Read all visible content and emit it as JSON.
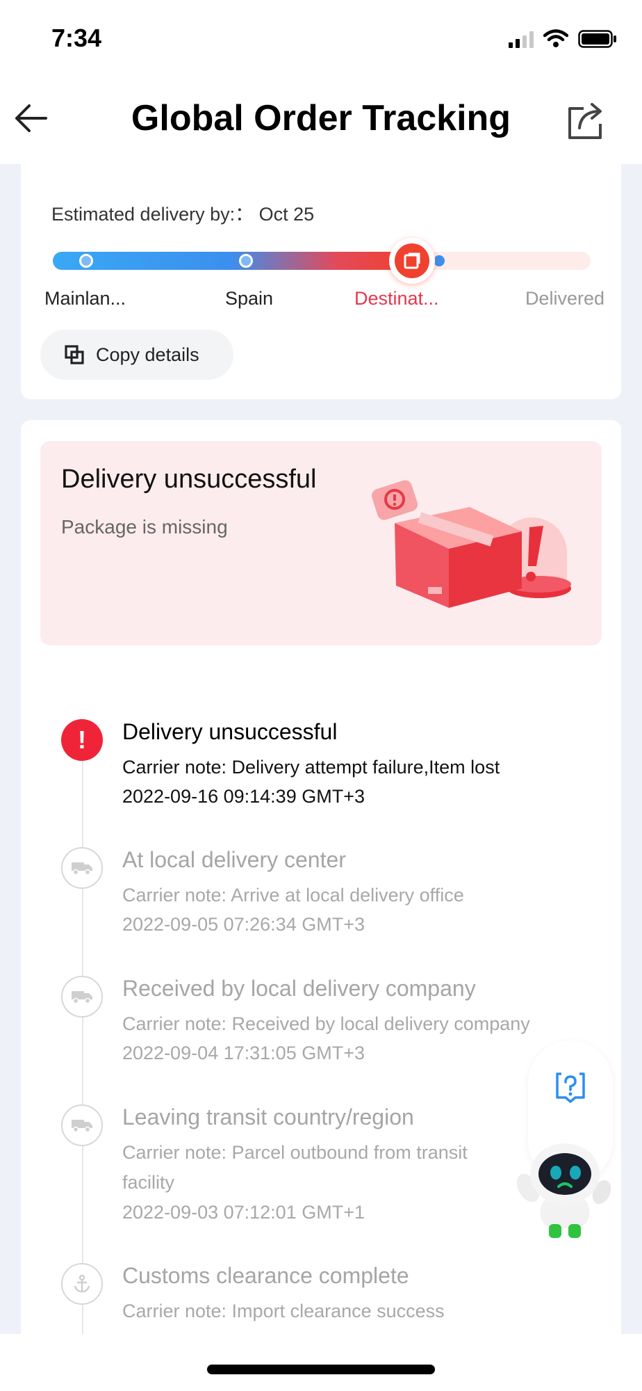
{
  "status_bar": {
    "time": "7:34"
  },
  "nav": {
    "title": "Global Order Tracking",
    "back_icon": "arrow-left-icon",
    "share_icon": "share-icon"
  },
  "summary": {
    "estimated_label": "Estimated delivery by:：",
    "estimated_value": "Oct 25",
    "stages": [
      "Mainlan...",
      "Spain",
      "Destinat...",
      "Delivered"
    ],
    "current_stage_index": 2,
    "progress_fraction": 0.66,
    "copy_label": "Copy details"
  },
  "alert": {
    "title": "Delivery unsuccessful",
    "subtitle": "Package is missing"
  },
  "events": [
    {
      "title": "Delivery unsuccessful",
      "note": "Carrier note: Delivery attempt failure,Item lost",
      "note2": "",
      "time": "2022-09-16 09:14:39 GMT+3",
      "icon": "exclamation-icon",
      "active": true
    },
    {
      "title": "At local delivery center",
      "note": "Carrier note: Arrive at local delivery office",
      "note2": "",
      "time": "2022-09-05 07:26:34 GMT+3",
      "icon": "truck-icon",
      "active": false
    },
    {
      "title": "Received by local delivery company",
      "note": "Carrier note: Received by local delivery company",
      "note2": "",
      "time": "2022-09-04 17:31:05 GMT+3",
      "icon": "truck-icon",
      "active": false
    },
    {
      "title": "Leaving transit country/region",
      "note": "Carrier note: Parcel outbound from transit",
      "note2": "facility",
      "time": "2022-09-03 07:12:01 GMT+1",
      "icon": "truck-icon",
      "active": false
    },
    {
      "title": "Customs clearance complete",
      "note": "Carrier note: Import clearance success",
      "note2": "",
      "time": "",
      "icon": "anchor-icon",
      "active": false
    }
  ],
  "colors": {
    "accent_red": "#f02438",
    "accent_blue": "#3b8fee"
  }
}
